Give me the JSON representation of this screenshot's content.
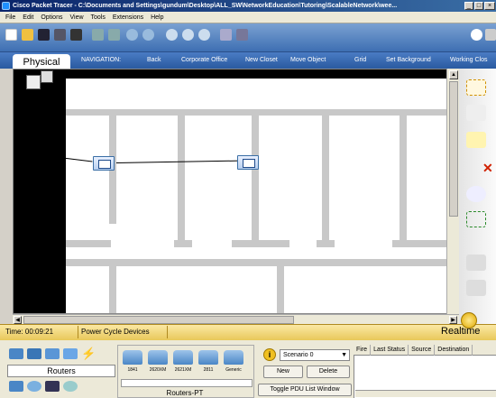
{
  "window": {
    "title": "Cisco Packet Tracer - C:\\Documents and Settings\\gundum\\Desktop\\ALL_SW\\NetworkEducation\\Tutoring\\ScalableNetwork\\wee..."
  },
  "menu": [
    "File",
    "Edit",
    "Options",
    "View",
    "Tools",
    "Extensions",
    "Help"
  ],
  "nav": {
    "physical_tab": "Physical",
    "navigation_label": "NAVIGATION:",
    "items": [
      "Back",
      "Corporate Office",
      "New Closet",
      "Move Object",
      "Grid",
      "Set Background",
      "Working Clos"
    ]
  },
  "status": {
    "time": "Time: 00:09:21",
    "power_cycle": "Power Cycle Devices",
    "mode": "Realtime"
  },
  "device_panel": {
    "category": "Routers",
    "devices": [
      "1841",
      "2620XM",
      "2621XM",
      "2811",
      "Generic"
    ],
    "subcategory": "Routers-PT"
  },
  "pdu": {
    "scenario": "Scenario 0",
    "new_label": "New",
    "delete_label": "Delete",
    "toggle_label": "Toggle PDU List Window"
  },
  "events_table": {
    "columns": [
      "Fire",
      "Last Status",
      "Source",
      "Destination"
    ]
  },
  "colors": {
    "toolbar": "#3e6fb3",
    "statusbar": "#e8c85a",
    "device": "#3a6ea5"
  }
}
